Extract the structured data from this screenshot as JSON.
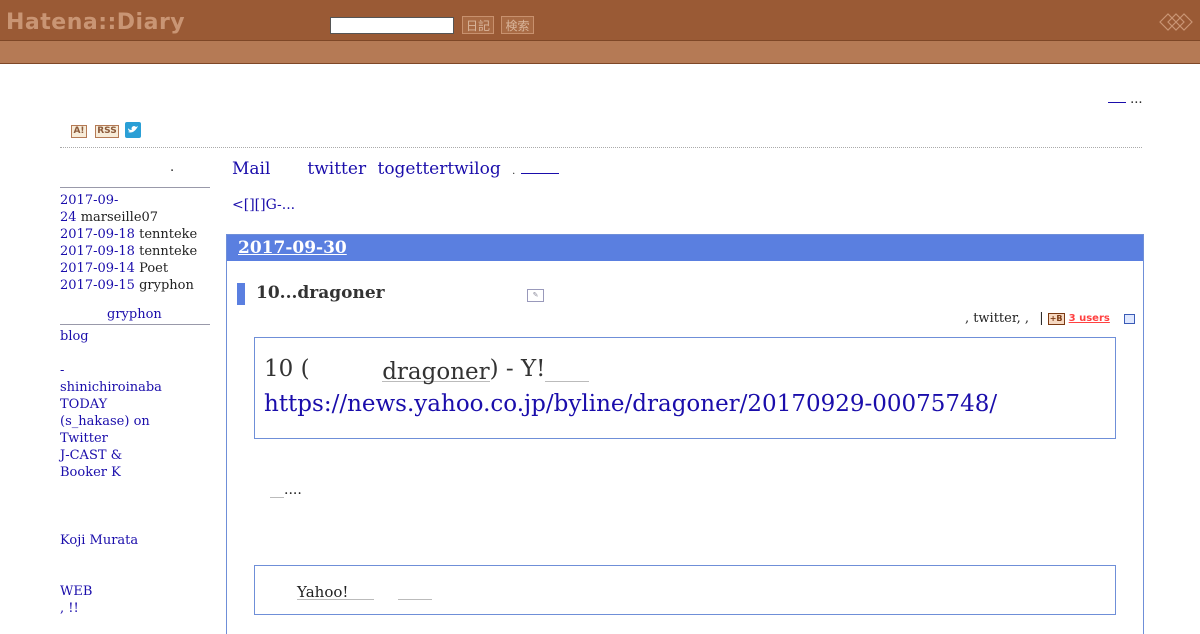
{
  "header": {
    "logo": "Hatena::Diary",
    "search_placeholder": "",
    "diary_button": "日記",
    "search_button": "検索"
  },
  "top_link": "...",
  "icons": {
    "antenna": "A!",
    "rss": "RSS",
    "twitter": "twitter-icon"
  },
  "sidebar": {
    "heading_dot": ".",
    "recent": [
      {
        "date": "2017-09-",
        "date2": "24",
        "user": "marseille07"
      },
      {
        "date": "2017-09-18",
        "user": "tennteke"
      },
      {
        "date": "2017-09-18",
        "user": "tennteke"
      },
      {
        "date": "2017-09-14",
        "user": "Poet"
      },
      {
        "date": "2017-09-15",
        "user": "gryphon"
      }
    ],
    "profile_name": "gryphon",
    "links": [
      "blog",
      "-",
      "shinichiroinaba",
      "TODAY",
      "(s_hakase) on",
      "Twitter",
      "J-CAST &",
      "Booker K",
      "Koji Murata",
      "WEB",
      ", !!"
    ]
  },
  "nav": {
    "mail": "Mail",
    "twitter": "twitter",
    "togetter": "togettertwilog",
    "dot": ".",
    "prev": "<[][]G-..."
  },
  "day": {
    "date": "2017-09-30",
    "section_title": "10...dragoner",
    "section_links_text": ", twitter, ,",
    "bookmark_icon": "+B",
    "bookmark_users": "3 users",
    "quote_title_prefix": "10  (",
    "quote_title_name": "dragoner",
    "quote_title_suffix": ") - Y!",
    "quote_url": "https://news.yahoo.co.jp/byline/dragoner/20170929-00075748/",
    "body_dots": "....",
    "box2_text": "Yahoo!"
  }
}
